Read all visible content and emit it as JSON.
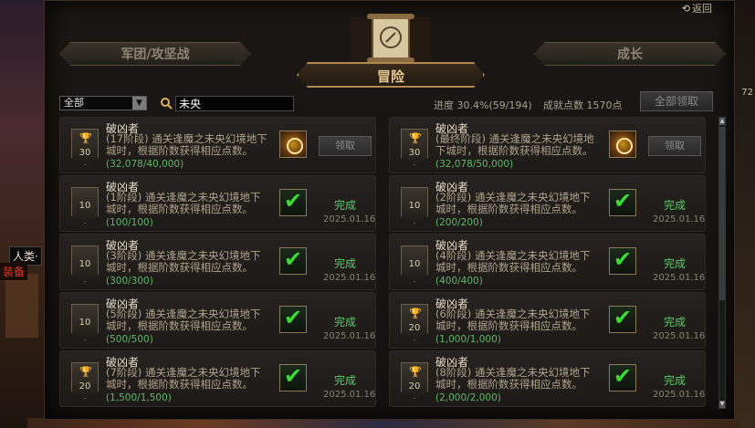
{
  "background": {
    "left_tag": "人类·",
    "left_tag2": "装备",
    "right_number": "72"
  },
  "header": {
    "back_label": "返回"
  },
  "tabs": [
    {
      "label": "军团/攻坚战",
      "active": false
    },
    {
      "label": "冒险",
      "active": true
    },
    {
      "label": "成长",
      "active": false
    }
  ],
  "toolbar": {
    "filter_value": "全部",
    "search_value": "未央",
    "progress_text": "进度 30.4%(59/194)",
    "points_text": "成就点数 1570点",
    "claim_all_label": "全部领取"
  },
  "achievements": [
    {
      "title": "破凶者",
      "desc": "(17阶段) 通关逢魔之未央幻境地下城时，根据阶数获得相应点数。",
      "progress": "(32,078/40,000)",
      "medal": "30",
      "trophy": true,
      "reward": "gear",
      "status": "claim",
      "action_label": "领取",
      "date": ""
    },
    {
      "title": "破凶者",
      "desc": "(最终阶段) 通关逢魔之未央幻境地下城时，根据阶数获得相应点数。",
      "progress": "(32,078/50,000)",
      "medal": "30",
      "trophy": true,
      "reward": "gear",
      "status": "claim",
      "action_label": "领取",
      "date": ""
    },
    {
      "title": "破凶者",
      "desc": "(1阶段) 通关逢魔之未央幻境地下城时，根据阶数获得相应点数。",
      "progress": "(100/100)",
      "medal": "10",
      "trophy": false,
      "reward": "done",
      "status": "done",
      "action_label": "完成",
      "date": "2025.01.16"
    },
    {
      "title": "破凶者",
      "desc": "(2阶段) 通关逢魔之未央幻境地下城时，根据阶数获得相应点数。",
      "progress": "(200/200)",
      "medal": "10",
      "trophy": false,
      "reward": "done",
      "status": "done",
      "action_label": "完成",
      "date": "2025.01.16"
    },
    {
      "title": "破凶者",
      "desc": "(3阶段) 通关逢魔之未央幻境地下城时，根据阶数获得相应点数。",
      "progress": "(300/300)",
      "medal": "10",
      "trophy": false,
      "reward": "done",
      "status": "done",
      "action_label": "完成",
      "date": "2025.01.16"
    },
    {
      "title": "破凶者",
      "desc": "(4阶段) 通关逢魔之未央幻境地下城时，根据阶数获得相应点数。",
      "progress": "(400/400)",
      "medal": "10",
      "trophy": false,
      "reward": "done",
      "status": "done",
      "action_label": "完成",
      "date": "2025.01.16"
    },
    {
      "title": "破凶者",
      "desc": "(5阶段) 通关逢魔之未央幻境地下城时，根据阶数获得相应点数。",
      "progress": "(500/500)",
      "medal": "10",
      "trophy": false,
      "reward": "done",
      "status": "done",
      "action_label": "完成",
      "date": "2025.01.16"
    },
    {
      "title": "破凶者",
      "desc": "(6阶段) 通关逢魔之未央幻境地下城时，根据阶数获得相应点数。",
      "progress": "(1,000/1,000)",
      "medal": "20",
      "trophy": true,
      "reward": "done",
      "status": "done",
      "action_label": "完成",
      "date": "2025.01.16"
    },
    {
      "title": "破凶者",
      "desc": "(7阶段) 通关逢魔之未央幻境地下城时，根据阶数获得相应点数。",
      "progress": "(1,500/1,500)",
      "medal": "20",
      "trophy": true,
      "reward": "done",
      "status": "done",
      "action_label": "完成",
      "date": "2025.01.16"
    },
    {
      "title": "破凶者",
      "desc": "(8阶段) 通关逢魔之未央幻境地下城时，根据阶数获得相应点数。",
      "progress": "(2,000/2,000)",
      "medal": "20",
      "trophy": true,
      "reward": "done",
      "status": "done",
      "action_label": "完成",
      "date": "2025.01.16"
    }
  ]
}
